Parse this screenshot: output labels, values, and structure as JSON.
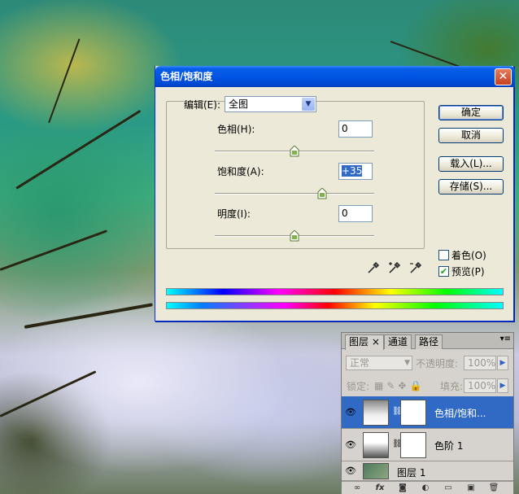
{
  "dialog": {
    "title": "色相/饱和度",
    "close_glyph": "✕",
    "edit_label": "编辑(E):",
    "edit_value": "全图",
    "hue_label": "色相(H):",
    "hue_value": "0",
    "hue_slider": 0,
    "saturation_label": "饱和度(A):",
    "saturation_value": "+35",
    "saturation_slider": 35,
    "lightness_label": "明度(I):",
    "lightness_value": "0",
    "lightness_slider": 0,
    "buttons": {
      "ok": "确定",
      "cancel": "取消",
      "load": "载入(L)...",
      "save": "存储(S)..."
    },
    "colorize_label": "着色(O)",
    "colorize_checked": false,
    "preview_label": "预览(P)",
    "preview_checked": true,
    "eyedropper_icons": [
      "eyedropper-icon",
      "eyedropper-plus-icon",
      "eyedropper-minus-icon"
    ]
  },
  "layers_panel": {
    "tabs": [
      "图层 ×",
      "通道",
      "路径"
    ],
    "blend_mode": "正常",
    "opacity_label": "不透明度:",
    "opacity_value": "100%",
    "lock_label": "锁定:",
    "fill_label": "填充:",
    "fill_value": "100%",
    "layers": [
      {
        "name": "色相/饱和...",
        "selected": true
      },
      {
        "name": "色阶 1",
        "selected": false
      },
      {
        "name": "图层 1",
        "selected": false
      }
    ],
    "bottom_icons": [
      "link-icon",
      "fx-icon",
      "mask-icon",
      "adjustment-icon",
      "folder-icon",
      "new-layer-icon",
      "trash-icon"
    ],
    "bottom_glyphs": [
      "∞",
      "fx",
      "◙",
      "◐",
      "▭",
      "▣",
      "🗑"
    ]
  },
  "colors": {
    "titlebar": "#0054e3",
    "selection": "#316ac5",
    "dialog_bg": "#ece9d8"
  }
}
